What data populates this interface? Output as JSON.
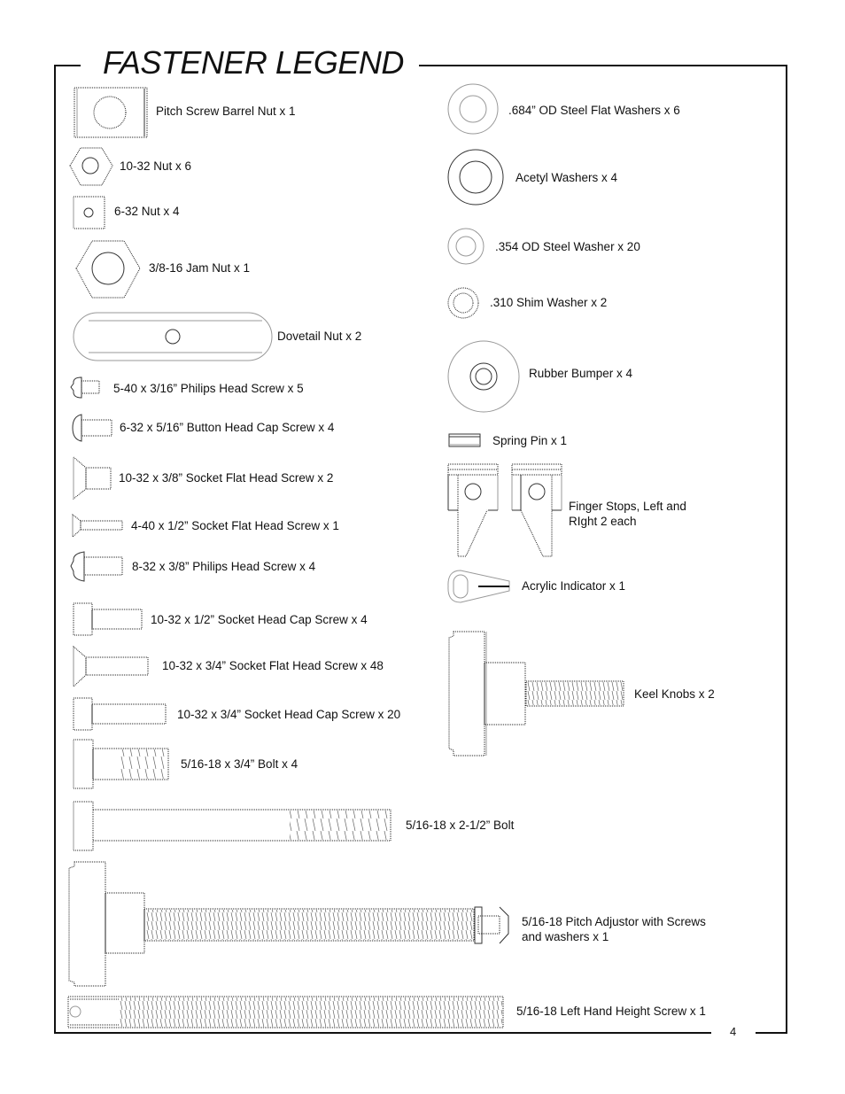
{
  "page": {
    "title": "FASTENER LEGEND",
    "page_number": "4"
  },
  "left_items": [
    {
      "label": "Pitch Screw Barrel Nut x 1",
      "icon": "barrel-nut-icon"
    },
    {
      "label": "10-32 Nut x 6",
      "icon": "hex-nut-icon"
    },
    {
      "label": "6-32 Nut x 4",
      "icon": "square-nut-icon"
    },
    {
      "label": "3/8-16 Jam Nut x 1",
      "icon": "jam-nut-icon"
    },
    {
      "label": "Dovetail Nut  x 2",
      "icon": "dovetail-nut-icon"
    },
    {
      "label": "5-40 x 3/16” Philips Head Screw x 5",
      "icon": "philips-screw-icon"
    },
    {
      "label": "6-32 x 5/16” Button Head Cap Screw x 4",
      "icon": "button-head-screw-icon"
    },
    {
      "label": "10-32 x 3/8” Socket Flat Head Screw x 2",
      "icon": "flat-head-screw-icon"
    },
    {
      "label": "4-40 x 1/2” Socket Flat Head Screw x 1",
      "icon": "flat-head-screw-icon"
    },
    {
      "label": "8-32 x 3/8” Philips Head Screw x 4",
      "icon": "philips-screw-icon"
    },
    {
      "label": "10-32 x 1/2” Socket Head Cap Screw x 4",
      "icon": "socket-cap-screw-icon"
    },
    {
      "label": "10-32 x 3/4” Socket Flat Head Screw x 48",
      "icon": "flat-head-screw-icon"
    },
    {
      "label": "10-32 x 3/4” Socket Head Cap Screw x 20",
      "icon": "socket-cap-screw-icon"
    },
    {
      "label": "5/16-18 x 3/4” Bolt x 4",
      "icon": "bolt-icon"
    },
    {
      "label": "5/16-18 x 2-1/2” Bolt",
      "icon": "long-bolt-icon"
    },
    {
      "label_line1": "5/16-18 Pitch Adjustor with Screws",
      "label_line2": "and washers x 1",
      "icon": "pitch-adjustor-icon"
    },
    {
      "label": "5/16-18 Left Hand Height Screw x 1",
      "icon": "height-screw-icon"
    }
  ],
  "right_items": [
    {
      "label": ".684” OD Steel Flat Washers x 6",
      "icon": "flat-washer-icon"
    },
    {
      "label": "Acetyl Washers x 4",
      "icon": "acetyl-washer-icon"
    },
    {
      "label": ".354 OD Steel Washer x 20",
      "icon": "steel-washer-icon"
    },
    {
      "label": ".310 Shim Washer x 2",
      "icon": "shim-washer-icon"
    },
    {
      "label": "Rubber Bumper x 4",
      "icon": "rubber-bumper-icon"
    },
    {
      "label": "Spring Pin x 1",
      "icon": "spring-pin-icon"
    },
    {
      "label_line1": "Finger Stops, Left and",
      "label_line2": "RIght 2 each",
      "icon": "finger-stops-icon"
    },
    {
      "label": "Acrylic Indicator x 1",
      "icon": "acrylic-indicator-icon"
    },
    {
      "label": "Keel Knobs x 2",
      "icon": "keel-knob-icon"
    }
  ]
}
